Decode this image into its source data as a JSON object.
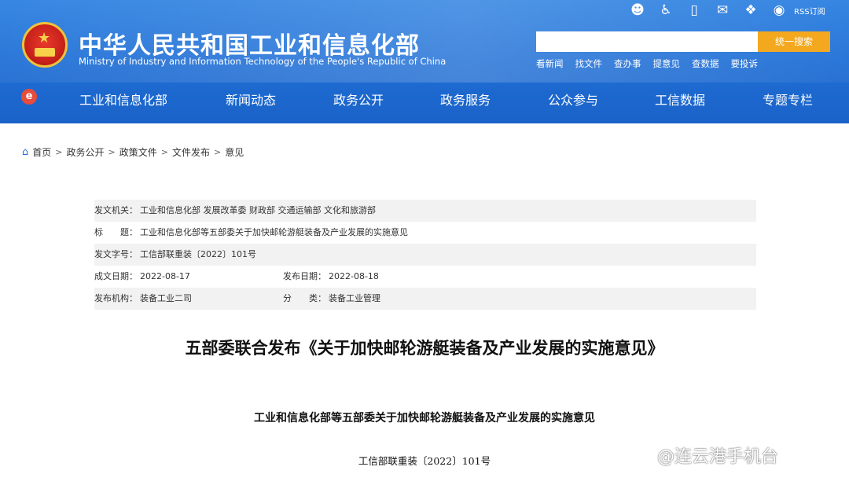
{
  "header": {
    "title_cn": "中华人民共和国工业和信息化部",
    "title_en": "Ministry of Industry and Information Technology of the People's Republic of China",
    "top_icons": [
      "mobile-person-icon",
      "accessibility-icon",
      "phone-icon",
      "mail-icon",
      "wechat-icon",
      "weibo-icon"
    ],
    "rss_label": "RSS订阅",
    "search_placeholder": "",
    "search_button": "统一搜索",
    "quick_links": [
      "看新闻",
      "找文件",
      "查办事",
      "提意见",
      "查数据",
      "要投诉"
    ],
    "accent": "#f4a81f",
    "brand": "#1f6fd6"
  },
  "nav": {
    "items": [
      "工业和信息化部",
      "新闻动态",
      "政务公开",
      "政务服务",
      "公众参与",
      "工信数据",
      "专题专栏"
    ]
  },
  "breadcrumb": [
    "首页",
    "政务公开",
    "政策文件",
    "文件发布",
    "意见"
  ],
  "meta": {
    "issuer_label": "发文机关：",
    "issuer": "工业和信息化部 发展改革委 财政部 交通运输部 文化和旅游部",
    "title_label": "标　　题：",
    "title": "工业和信息化部等五部委关于加快邮轮游艇装备及产业发展的实施意见",
    "docno_label": "发文字号：",
    "docno": "工信部联重装〔2022〕101号",
    "created_label": "成文日期：",
    "created": "2022-08-17",
    "published_label": "发布日期：",
    "published": "2022-08-18",
    "org_label": "发布机构：",
    "org": "装备工业二司",
    "category_label": "分　　类：",
    "category": "装备工业管理"
  },
  "article": {
    "title": "五部委联合发布《关于加快邮轮游艇装备及产业发展的实施意见》",
    "subtitle": "工业和信息化部等五部委关于加快邮轮游艇装备及产业发展的实施意见",
    "doc_number": "工信部联重装〔2022〕101号"
  },
  "watermark": "@连云港手机台"
}
